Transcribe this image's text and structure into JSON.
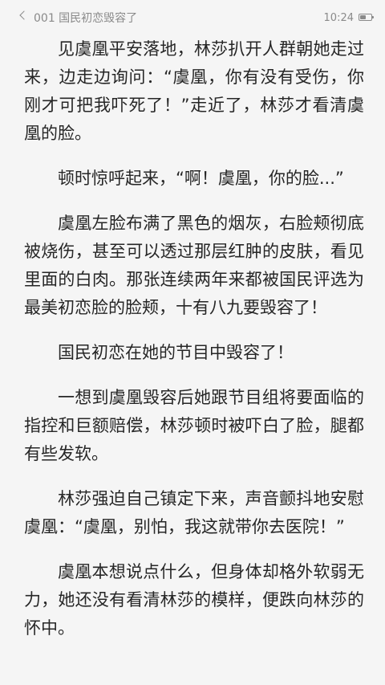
{
  "status_bar": {
    "back_label": "<",
    "chapter_title": "001 国民初恋毁容了",
    "time": "10:24",
    "battery_level": 0.5
  },
  "paragraphs": [
    "见虞凰平安落地，林莎扒开人群朝她走过来，边走边询问：“虞凰，你有没有受伤，你刚才可把我吓死了！”走近了，林莎才看清虞凰的脸。",
    "顿时惊呼起来，“啊！虞凰，你的脸...”",
    "虞凰左脸布满了黑色的烟灰，右脸颊彻底被烧伤，甚至可以透过那层红肿的皮肤，看见里面的白肉。那张连续两年来都被国民评选为最美初恋脸的脸颊，十有八九要毁容了！",
    "国民初恋在她的节目中毁容了！",
    "一想到虞凰毁容后她跟节目组将要面临的指控和巨额赔偿，林莎顿时被吓白了脸，腿都有些发软。",
    "林莎强迫自己镇定下来，声音颤抖地安慰虞凰：“虞凰，别怕，我这就带你去医院！”",
    "虞凰本想说点什么，但身体却格外软弱无力，她还没有看清林莎的模样，便跌向林莎的怀中。"
  ]
}
